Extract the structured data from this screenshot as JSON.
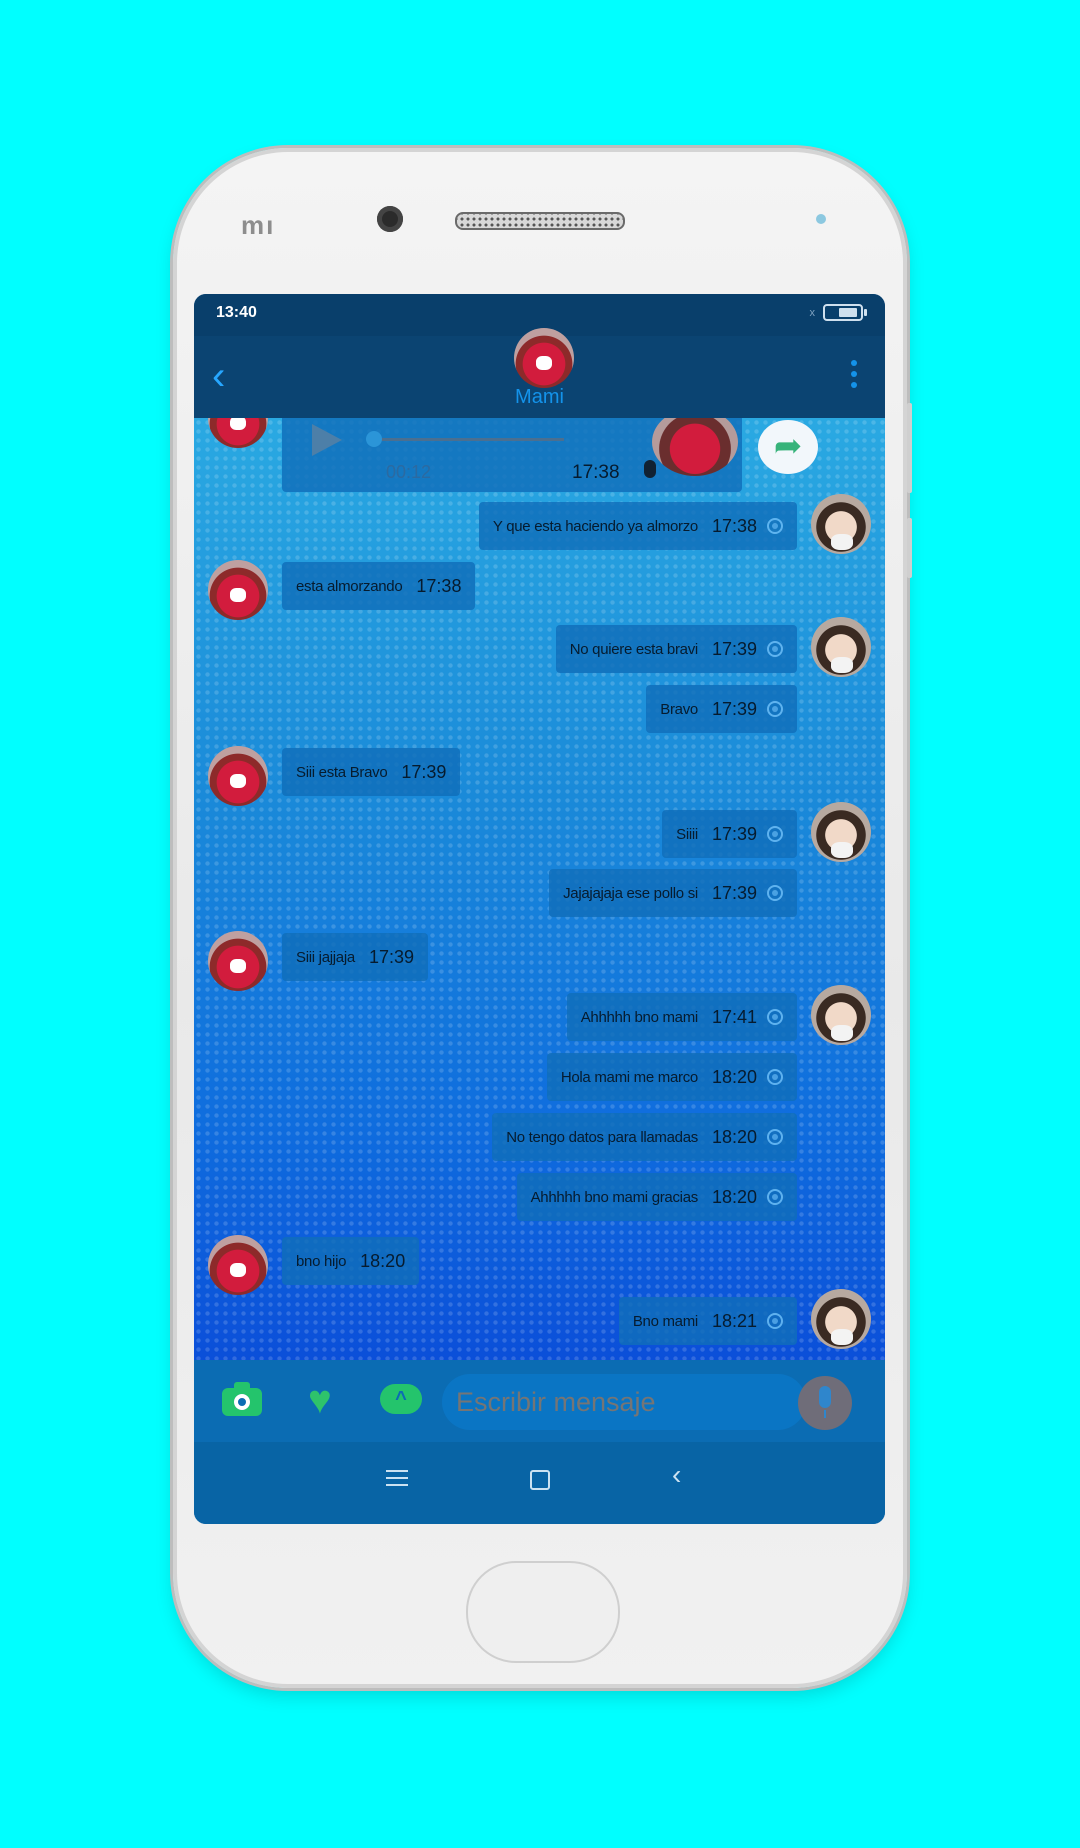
{
  "status_bar": {
    "time": "13:40",
    "signal": "x"
  },
  "header": {
    "contact_name": "Mami",
    "back_icon": "chevron-left-icon",
    "menu_icon": "more-vert-icon"
  },
  "audio_message": {
    "duration": "00:12",
    "time": "17:38"
  },
  "messages": [
    {
      "dir": "out",
      "text": "Y que esta haciendo ya almorzo",
      "time": "17:38",
      "avatar": true
    },
    {
      "dir": "in",
      "text": "esta almorzando",
      "time": "17:38",
      "avatar": true
    },
    {
      "dir": "out",
      "text": "No quiere esta bravi",
      "time": "17:39",
      "avatar": true
    },
    {
      "dir": "out",
      "text": "Bravo",
      "time": "17:39",
      "avatar": false
    },
    {
      "dir": "in",
      "text": "Siii esta Bravo",
      "time": "17:39",
      "avatar": true
    },
    {
      "dir": "out",
      "text": "Siiii",
      "time": "17:39",
      "avatar": true
    },
    {
      "dir": "out",
      "text": "Jajajajaja ese pollo si",
      "time": "17:39",
      "avatar": false
    },
    {
      "dir": "in",
      "text": "Siii jajjaja",
      "time": "17:39",
      "avatar": true
    },
    {
      "dir": "out",
      "text": "Ahhhhh bno mami",
      "time": "17:41",
      "avatar": true
    },
    {
      "dir": "out",
      "text": "Hola mami me marco",
      "time": "18:20",
      "avatar": false
    },
    {
      "dir": "out",
      "text": "No tengo datos para llamadas",
      "time": "18:20",
      "avatar": false
    },
    {
      "dir": "out",
      "text": "Ahhhhh bno mami gracias",
      "time": "18:20",
      "avatar": false
    },
    {
      "dir": "in",
      "text": "bno hijo",
      "time": "18:20",
      "avatar": true
    },
    {
      "dir": "out",
      "text": "Bno mami",
      "time": "18:21",
      "avatar": true
    }
  ],
  "composer": {
    "placeholder": "Escribir mensaje"
  },
  "colors": {
    "accent": "#1493ea",
    "green": "#24c46c",
    "background": "#00ffff"
  }
}
